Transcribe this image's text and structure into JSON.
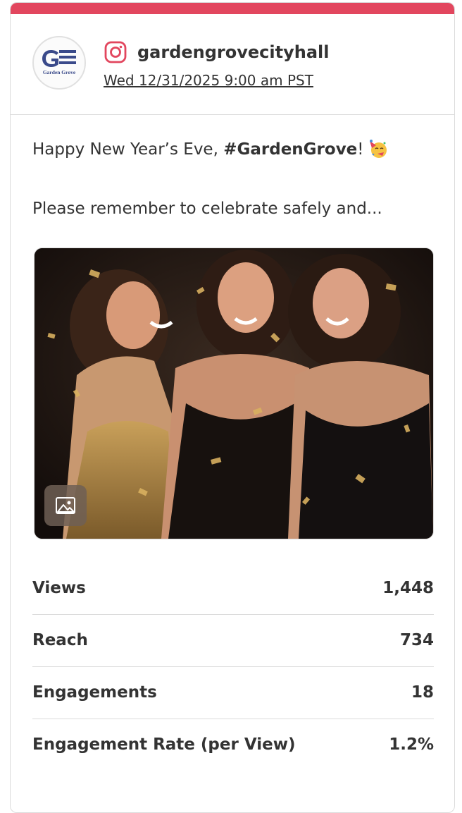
{
  "post": {
    "account_handle": "gardengrovecityhall",
    "timestamp": "Wed 12/31/2025 9:00 am PST",
    "network": "instagram",
    "avatar": {
      "logo_letter": "G",
      "logo_text": "Garden Grove"
    },
    "caption": {
      "line1_prefix": "Happy New Year’s Eve, ",
      "line1_hashtag": "#GardenGrove",
      "line1_suffix": "!",
      "line1_emoji": "partying-face-emoji",
      "line2": "Please remember to celebrate safely and..."
    },
    "media": {
      "badge_icon": "image-icon"
    }
  },
  "metrics": [
    {
      "label": "Views",
      "value": "1,448"
    },
    {
      "label": "Reach",
      "value": "734"
    },
    {
      "label": "Engagements",
      "value": "18"
    },
    {
      "label": "Engagement Rate (per View)",
      "value": "1.2%"
    }
  ],
  "colors": {
    "accent": "#e2465e",
    "text": "#333333",
    "divider": "#dcdcdc"
  }
}
